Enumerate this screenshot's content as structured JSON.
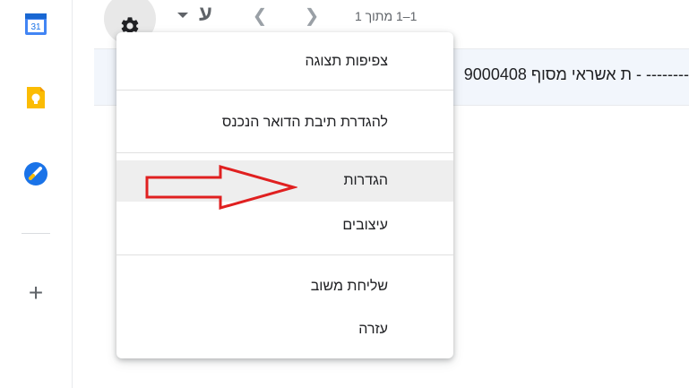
{
  "toolbar": {
    "settings_icon": "gear-icon",
    "language_char": "ע",
    "prev_icon": "chevron-left-icon",
    "next_icon": "chevron-right-icon",
    "page_count": "1–1 מתוך 1"
  },
  "sidebar": {
    "apps": [
      {
        "name": "calendar-icon",
        "label": "31"
      },
      {
        "name": "keep-icon"
      },
      {
        "name": "tasks-icon"
      }
    ],
    "add_icon": "plus-icon"
  },
  "email": {
    "subject": "ת אשראי מסוף 9000408 - --------"
  },
  "settings_menu": {
    "items": [
      {
        "label": "צפיפות תצוגה"
      },
      {
        "label": "להגדרת תיבת הדואר הנכנס"
      },
      {
        "label": "הגדרות",
        "highlighted": true
      },
      {
        "label": "עיצובים"
      },
      {
        "label": "שליחת משוב"
      },
      {
        "label": "עזרה"
      }
    ]
  },
  "annotation": {
    "color": "#e02020",
    "shape": "arrow-right"
  }
}
